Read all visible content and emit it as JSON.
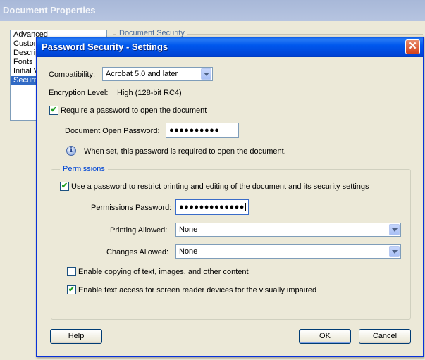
{
  "background_window": {
    "title": "Document Properties",
    "list_items": [
      "Advanced",
      "Custom",
      "Description",
      "Fonts",
      "Initial View",
      "Security"
    ],
    "selected_index": 5,
    "group_label": "Document Security"
  },
  "dialog": {
    "title": "Password Security - Settings",
    "close_glyph": "✕",
    "compatibility_label": "Compatibility:",
    "compatibility_value": "Acrobat 5.0 and later",
    "encryption_label": "Encryption  Level:",
    "encryption_value": "High (128-bit RC4)",
    "require_open_password_label": "Require a password to open the document",
    "require_open_password_checked": true,
    "open_password_label": "Document Open Password:",
    "open_password_value": "●●●●●●●●●●",
    "info_glyph": "i",
    "info_text": "When set, this password is required to open the document.",
    "permissions": {
      "legend": "Permissions",
      "use_password_label": "Use a password to restrict printing and editing of the document and its security settings",
      "use_password_checked": true,
      "permissions_password_label": "Permissions Password:",
      "permissions_password_value": "●●●●●●●●●●●●●",
      "printing_allowed_label": "Printing Allowed:",
      "printing_allowed_value": "None",
      "changes_allowed_label": "Changes Allowed:",
      "changes_allowed_value": "None",
      "enable_copying_label": "Enable copying of text, images, and other content",
      "enable_copying_checked": false,
      "enable_text_access_label": "Enable text access for screen reader devices for the visually impaired",
      "enable_text_access_checked": true
    },
    "help_button": "Help",
    "ok_button": "OK",
    "cancel_button": "Cancel",
    "check_glyph": "✔"
  }
}
